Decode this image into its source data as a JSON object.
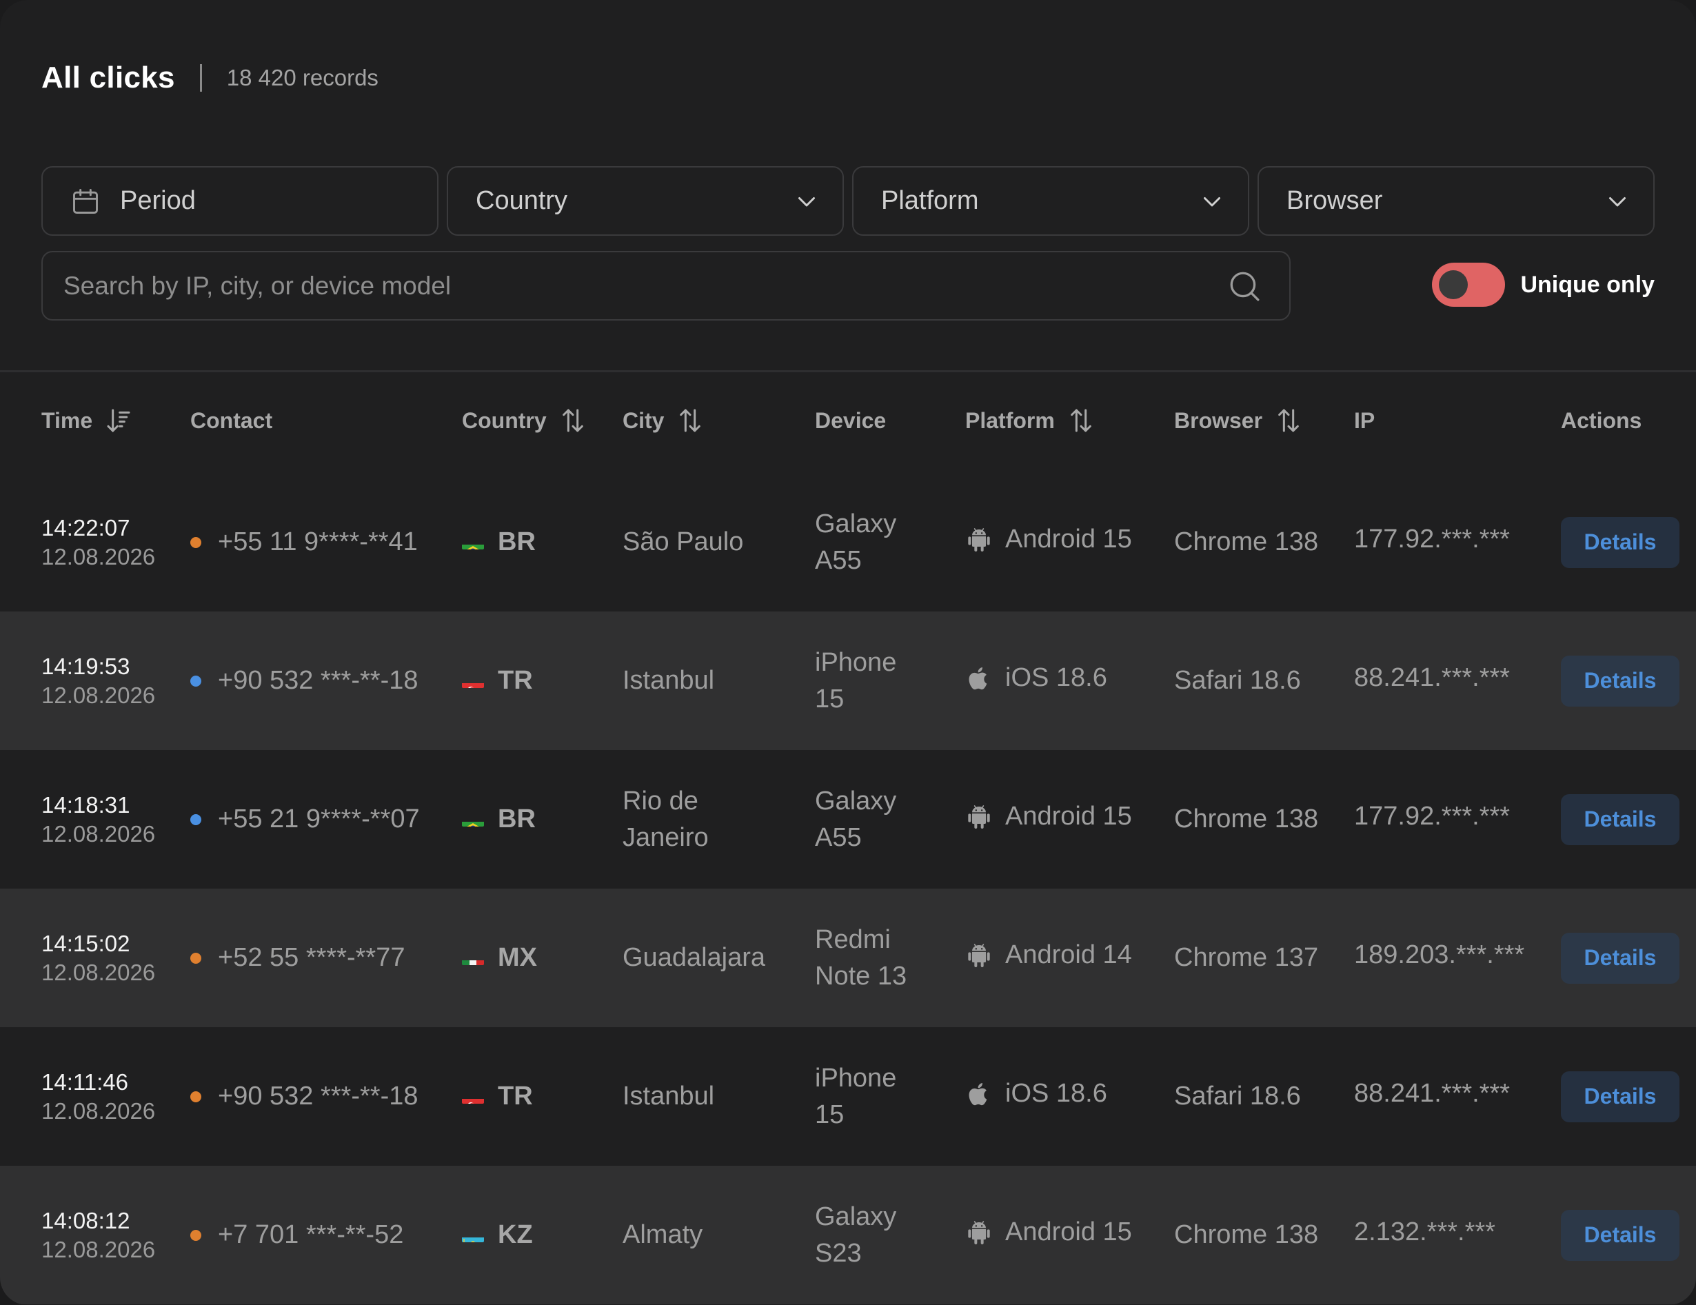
{
  "header": {
    "title": "All clicks",
    "records": "18 420 records"
  },
  "filters": {
    "period": "Period",
    "country": "Country",
    "platform": "Platform",
    "browser": "Browser"
  },
  "search": {
    "placeholder": "Search by IP, city, or device model"
  },
  "toggle": {
    "label": "Unique only",
    "on": true,
    "color": "#e06464"
  },
  "columns": {
    "time": "Time",
    "contact": "Contact",
    "country": "Country",
    "city": "City",
    "device": "Device",
    "platform": "Platform",
    "browser": "Browser",
    "ip": "IP",
    "actions": "Actions"
  },
  "rows": [
    {
      "time": "14:22:07",
      "date": "12.08.2026",
      "dot": "#e0802f",
      "contact": "+55 11 9****-**41",
      "flag": "br",
      "country": "BR",
      "city": "São Paulo",
      "device": "Galaxy A55",
      "device1": "Galaxy",
      "device2": "A55",
      "platform_icon": "android-icon",
      "platform": "Android 15",
      "browser": "Chrome 138",
      "ip": "177.92.***.***",
      "action": "Details"
    },
    {
      "time": "14:19:53",
      "date": "12.08.2026",
      "dot": "#4a90e2",
      "contact": "+90 532 ***-**-18",
      "flag": "tr",
      "country": "TR",
      "city": "Istanbul",
      "device": "iPhone 15",
      "device1": "iPhone",
      "device2": "15",
      "platform_icon": "apple-icon",
      "platform": "iOS 18.6",
      "browser": "Safari 18.6",
      "ip": "88.241.***.***",
      "action": "Details"
    },
    {
      "time": "14:18:31",
      "date": "12.08.2026",
      "dot": "#4a90e2",
      "contact": "+55 21 9****-**07",
      "flag": "br",
      "country": "BR",
      "city1": "Rio de",
      "city2": "Janeiro",
      "device": "Galaxy A55",
      "device1": "Galaxy",
      "device2": "A55",
      "platform_icon": "android-icon",
      "platform": "Android 15",
      "browser": "Chrome 138",
      "ip": "177.92.***.***",
      "action": "Details"
    },
    {
      "time": "14:15:02",
      "date": "12.08.2026",
      "dot": "#e0802f",
      "contact": "+52 55 ****-**77",
      "flag": "mx",
      "country": "MX",
      "city": "Guadalajara",
      "device": "Redmi Note 13",
      "device1": "Redmi",
      "device2": "Note 13",
      "platform_icon": "android-icon",
      "platform": "Android 14",
      "browser": "Chrome 137",
      "ip": "189.203.***.***",
      "action": "Details"
    },
    {
      "time": "14:11:46",
      "date": "12.08.2026",
      "dot": "#e0802f",
      "contact": "+90 532 ***-**-18",
      "flag": "tr",
      "country": "TR",
      "city": "Istanbul",
      "device": "iPhone 15",
      "device1": "iPhone",
      "device2": "15",
      "platform_icon": "apple-icon",
      "platform": "iOS 18.6",
      "browser": "Safari 18.6",
      "ip": "88.241.***.***",
      "action": "Details"
    },
    {
      "time": "14:08:12",
      "date": "12.08.2026",
      "dot": "#e0802f",
      "contact": "+7 701 ***-**-52",
      "flag": "kz",
      "country": "KZ",
      "city": "Almaty",
      "device": "Galaxy S23",
      "device1": "Galaxy",
      "device2": "S23",
      "platform_icon": "android-icon",
      "platform": "Android 15",
      "browser": "Chrome 138",
      "ip": "2.132.***.***",
      "action": "Details"
    }
  ]
}
